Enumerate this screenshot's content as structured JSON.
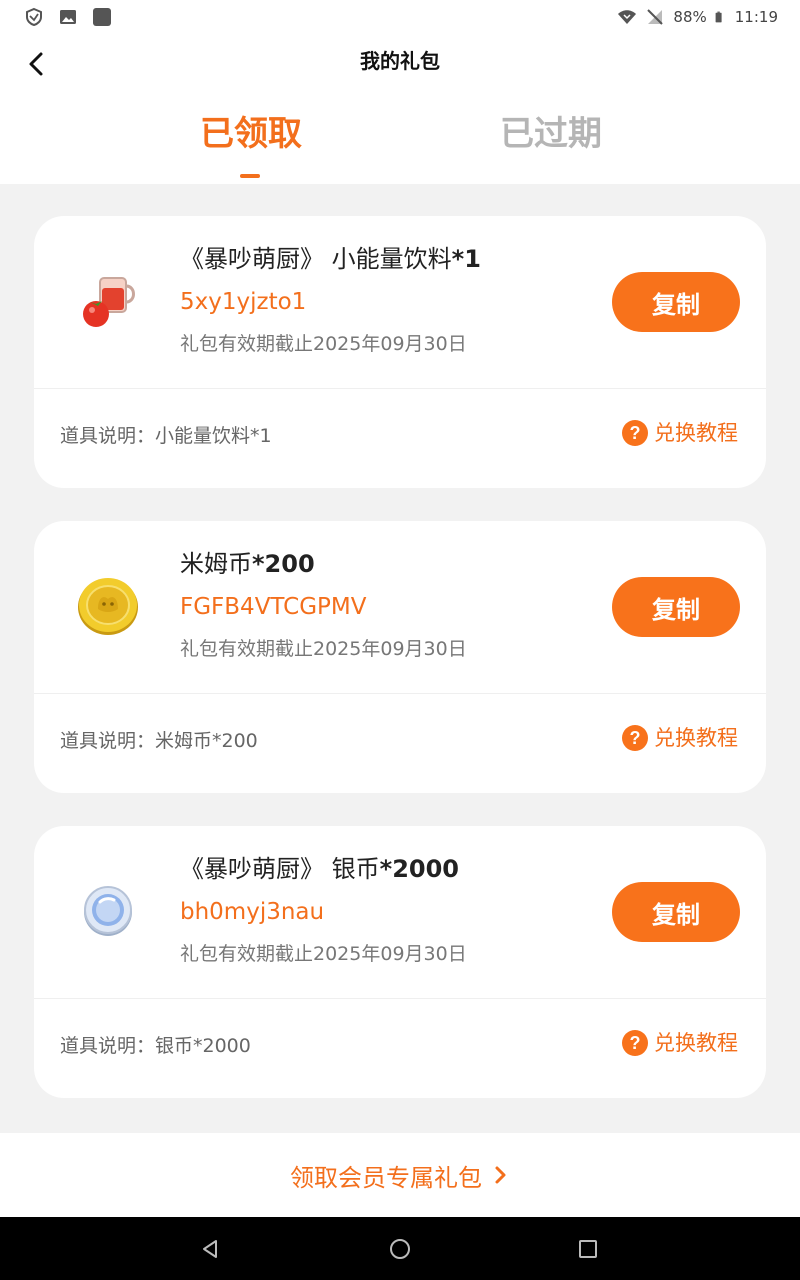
{
  "status_bar": {
    "battery": "88%",
    "time": "11:19"
  },
  "header": {
    "title": "我的礼包",
    "tabs": [
      {
        "label": "已领取",
        "active": true
      },
      {
        "label": "已过期",
        "active": false
      }
    ]
  },
  "gifts": [
    {
      "name_prefix": "《暴吵萌厨》 小能量饮料",
      "quantity": "*1",
      "code": "5xy1yjzto1",
      "expiry": "礼包有效期截止2025年09月30日",
      "copy_label": "复制",
      "description": "道具说明：小能量饮料*1",
      "tutorial_label": "兑换教程",
      "icon": "energy-drink-icon"
    },
    {
      "name_prefix": "米姆币",
      "quantity": "*200",
      "code": "FGFB4VTCGPMV",
      "expiry": "礼包有效期截止2025年09月30日",
      "copy_label": "复制",
      "description": "道具说明：米姆币*200",
      "tutorial_label": "兑换教程",
      "icon": "gold-coin-icon"
    },
    {
      "name_prefix": "《暴吵萌厨》 银币",
      "quantity": "*2000",
      "code": "bh0myj3nau",
      "expiry": "礼包有效期截止2025年09月30日",
      "copy_label": "复制",
      "description": "道具说明：银币*2000",
      "tutorial_label": "兑换教程",
      "icon": "silver-coin-icon"
    }
  ],
  "bottom": {
    "label": "领取会员专属礼包"
  },
  "colors": {
    "accent": "#f36f1c",
    "button": "#f8721b",
    "inactive_tab": "#b5b5b5",
    "background": "#f2f2f2"
  }
}
